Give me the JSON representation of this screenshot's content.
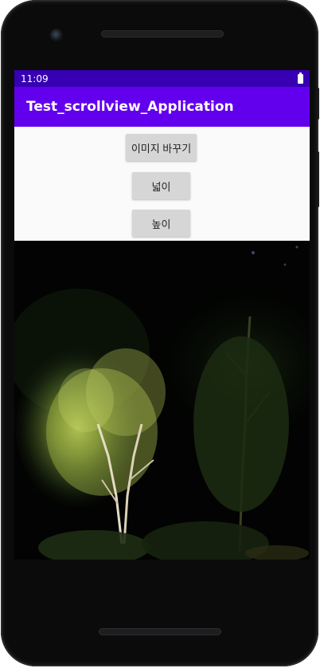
{
  "status_bar": {
    "time": "11:09"
  },
  "app_bar": {
    "title": "Test_scrollview_Application"
  },
  "buttons": {
    "change_image": "이미지 바꾸기",
    "width": "넓이",
    "height": "높이"
  },
  "colors": {
    "status_bar": "#3700b3",
    "app_bar": "#6200ee",
    "controls_bg": "#fafafa",
    "button_bg": "#d6d6d6"
  },
  "icons": [
    "battery-icon"
  ],
  "image": {
    "subject": "night-garden-trees-photo"
  }
}
